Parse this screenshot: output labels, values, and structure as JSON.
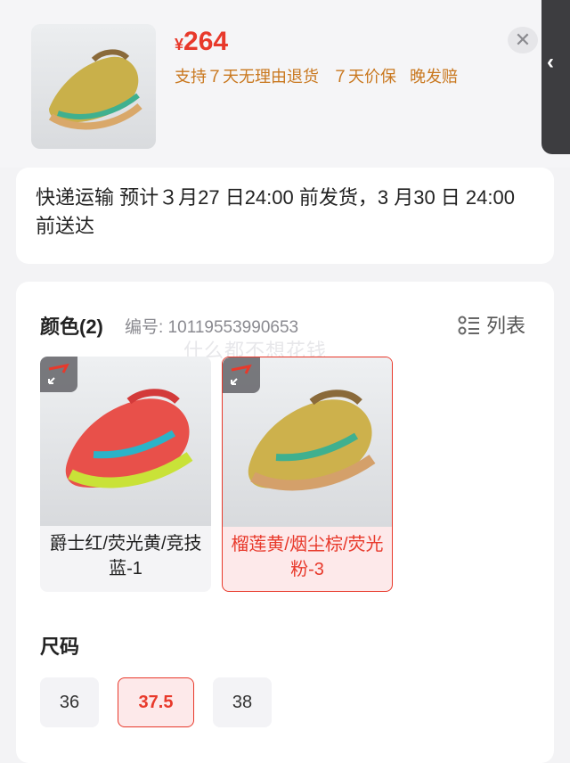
{
  "header": {
    "currency": "¥",
    "price": "264",
    "promos": [
      "支持７天无理由退货",
      "７天价保",
      "晚发赔"
    ],
    "close_icon": "close-icon"
  },
  "side": {
    "chevron": "‹"
  },
  "delivery": {
    "text": "快递运输 预计３月27 日24:00 前发货，3 月30 日 24:00 前送达"
  },
  "colors": {
    "title": "颜色(2)",
    "code_label": "编号: 10119553990653",
    "list_label": "列表",
    "watermark": "什么都不想花钱",
    "items": [
      {
        "label": "爵士红/荧光黄/竞技蓝-1",
        "selected": false
      },
      {
        "label": "榴莲黄/烟尘棕/荧光粉-3",
        "selected": true
      }
    ]
  },
  "sizes": {
    "title": "尺码",
    "items": [
      {
        "label": "36",
        "selected": false
      },
      {
        "label": "37.5",
        "selected": true
      },
      {
        "label": "38",
        "selected": false
      }
    ]
  },
  "palette": {
    "accent": "#e8392b",
    "promo": "#c9781f"
  }
}
